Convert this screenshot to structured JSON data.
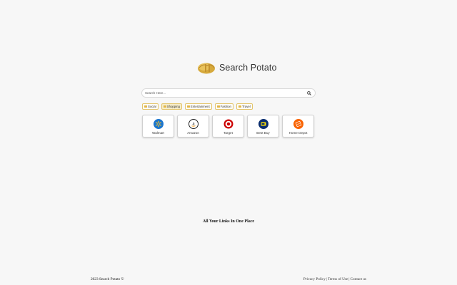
{
  "brand": {
    "name": "Search Potato"
  },
  "search": {
    "placeholder": "Search Here...",
    "icon": "search-icon"
  },
  "categories": [
    {
      "label": "Social",
      "icon": "folder-icon",
      "active": false
    },
    {
      "label": "Shopping",
      "icon": "folder-icon",
      "active": true
    },
    {
      "label": "Entertainment",
      "icon": "folder-icon",
      "active": false
    },
    {
      "label": "Fashion",
      "icon": "folder-icon",
      "active": false
    },
    {
      "label": "Travel",
      "icon": "folder-icon",
      "active": false
    }
  ],
  "shortcuts": [
    {
      "label": "Walmart",
      "icon": "walmart-icon",
      "color": "#1a75cf"
    },
    {
      "label": "Amazon",
      "icon": "amazon-icon",
      "color": "#111111"
    },
    {
      "label": "Target",
      "icon": "target-icon",
      "color": "#cc0000"
    },
    {
      "label": "Best Buy",
      "icon": "bestbuy-icon",
      "color": "#0046be"
    },
    {
      "label": "Home Depot",
      "icon": "homedepot-icon",
      "color": "#f96302"
    }
  ],
  "tagline": "All Your Links In One Place",
  "footer": {
    "copyright": "2023 Search Potato ©",
    "links": [
      "Privacy Policy",
      "Terms of Use",
      "Contact us"
    ],
    "separator": "|"
  },
  "colors": {
    "accent": "#e1b64a",
    "background": "#f7f7f7"
  }
}
